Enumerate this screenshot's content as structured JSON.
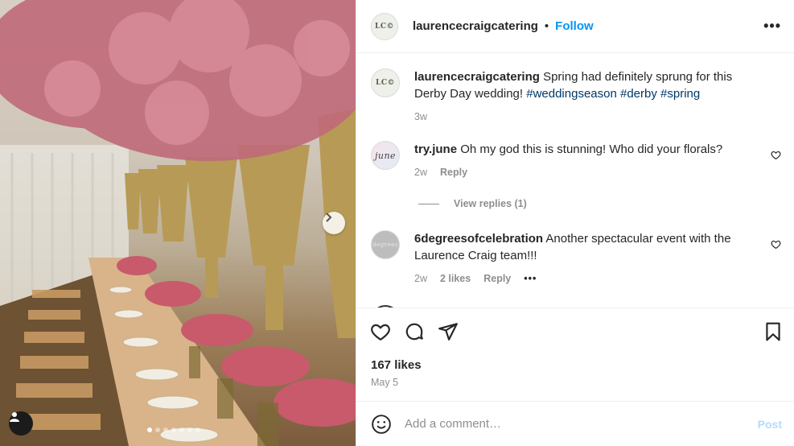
{
  "post": {
    "username": "laurencecraigcatering",
    "follow_label": "Follow",
    "separator": "•",
    "avatar_monogram": "LC©",
    "more_label": "•••"
  },
  "caption": {
    "username": "laurencecraigcatering",
    "text": " Spring had definitely sprung for this Derby Day wedding! ",
    "tags": [
      "#weddingseason",
      "#derby",
      "#spring"
    ],
    "age": "3w"
  },
  "comments": [
    {
      "username": "try.june",
      "avatar_text": "june",
      "text": " Oh my god this is stunning! Who did your florals?",
      "age": "2w",
      "reply_label": "Reply"
    },
    {
      "username": "6degreesofcelebration",
      "avatar_text": "degrees",
      "text": " Another spectacular event with the Laurence Craig team!!!",
      "age": "2w",
      "likes": "2 likes",
      "reply_label": "Reply",
      "more_label": "•••"
    }
  ],
  "view_replies": "View replies (1)",
  "likes": "167 likes",
  "date": "May 5",
  "add_comment": {
    "placeholder": "Add a comment…",
    "post_label": "Post"
  },
  "carousel": {
    "count": 7,
    "active_index": 0
  },
  "colors": {
    "accent": "#0095f6",
    "hashtag": "#00376b",
    "muted": "#8e8e8e",
    "post_disabled": "#b3dbff"
  },
  "icons": [
    "heart-icon",
    "comment-icon",
    "share-icon",
    "bookmark-icon",
    "emoji-icon",
    "chevron-right-icon",
    "user-tag-icon"
  ]
}
